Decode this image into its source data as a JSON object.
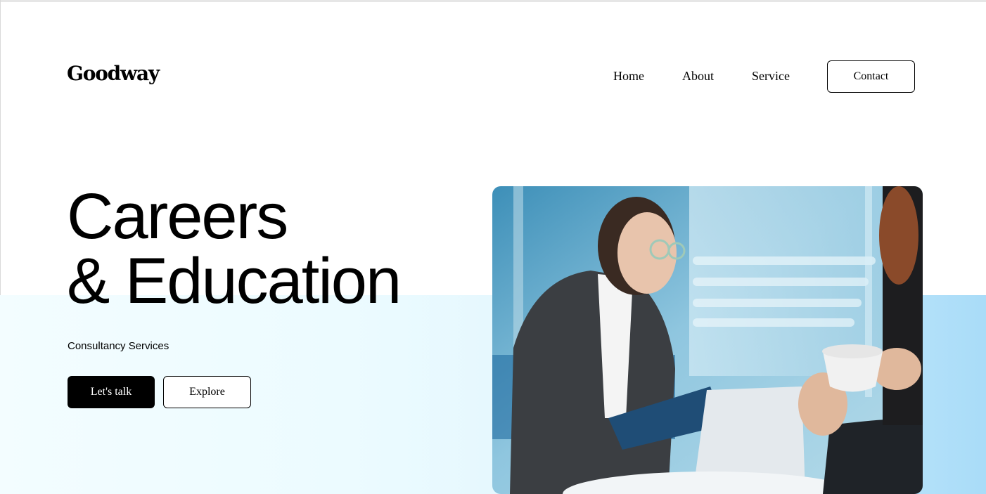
{
  "brand": {
    "logo": "Goodway"
  },
  "nav": {
    "home": "Home",
    "about": "About",
    "service": "Service",
    "contact": "Contact"
  },
  "hero": {
    "title_line1": "Careers",
    "title_line2": "& Education",
    "subtitle": "Consultancy Services",
    "cta_primary": "Let's talk",
    "cta_secondary": "Explore"
  },
  "colors": {
    "primary_button": "#000000",
    "hero_band_start": "#f3fdff",
    "hero_band_end": "#a9dcf8"
  }
}
